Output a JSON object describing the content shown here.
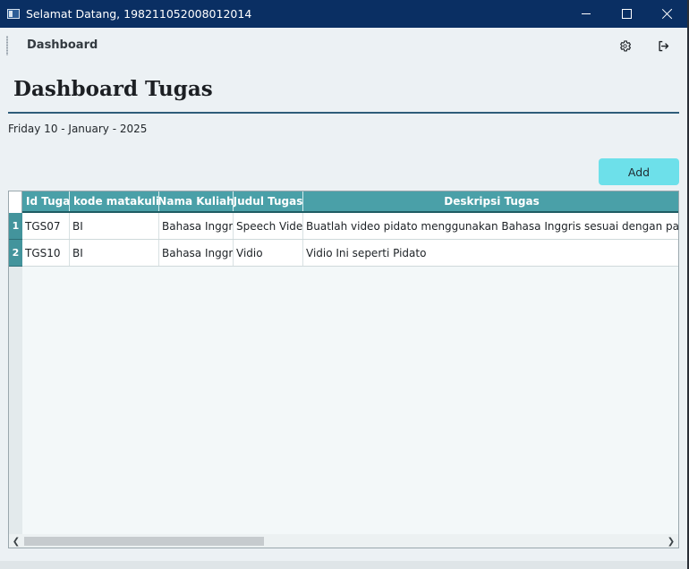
{
  "window": {
    "title": "Selamat Datang, 198211052008012014",
    "titlebar_color": "#0a2f63"
  },
  "toolbar": {
    "nav_label": "Dashboard",
    "icons": [
      "gear-icon",
      "logout-icon"
    ]
  },
  "page": {
    "title": "Dashboard Tugas",
    "date": "Friday 10 - January - 2025",
    "add_label": "Add"
  },
  "table": {
    "columns": [
      "Id Tugas",
      "kode matakuliah",
      "Nama Kuliah",
      "Judul Tugas",
      "Deskripsi Tugas"
    ],
    "rows": [
      {
        "num": "1",
        "cells": [
          "TGS07",
          "BI",
          "Bahasa Inggris",
          "Speech Video",
          "Buatlah video pidato menggunakan Bahasa Inggris sesuai dengan panduan yang"
        ]
      },
      {
        "num": "2",
        "cells": [
          "TGS10",
          "BI",
          "Bahasa Inggris",
          "Vidio",
          "Vidio Ini seperti Pidato"
        ]
      }
    ]
  },
  "colors": {
    "header": "#4aa0a8",
    "row_header": "#43949c",
    "add_button": "#6de0ea",
    "title_rule": "#2f5d7a"
  }
}
